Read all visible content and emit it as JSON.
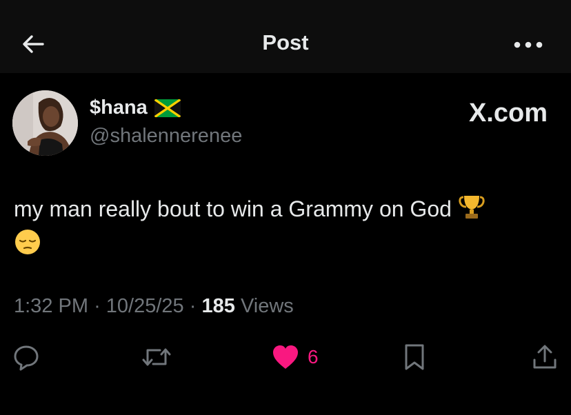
{
  "header": {
    "title": "Post",
    "back_icon": "arrow-left-icon",
    "more_icon": "more-horizontal-icon"
  },
  "author": {
    "display_name": "$hana",
    "flag_emoji": "jamaica-flag",
    "handle": "@shalennerenee"
  },
  "brand": {
    "site_label": "X.com"
  },
  "post": {
    "text": "my man really bout to win a Grammy on God",
    "emoji_1": "trophy",
    "emoji_2": "pensive-face"
  },
  "meta": {
    "time": "1:32 PM",
    "sep1": "·",
    "date": "10/25/25",
    "sep2": "·",
    "views_count": "185",
    "views_label": "Views"
  },
  "actions": {
    "reply_icon": "reply-icon",
    "repost_icon": "repost-icon",
    "like_icon": "heart-icon",
    "likes_count": "6",
    "bookmark_icon": "bookmark-icon",
    "share_icon": "share-icon"
  },
  "colors": {
    "background": "#000000",
    "header_bg": "#0d0d0d",
    "primary_text": "#e7e9ea",
    "secondary_text": "#71767b",
    "like_pink": "#f91880"
  }
}
